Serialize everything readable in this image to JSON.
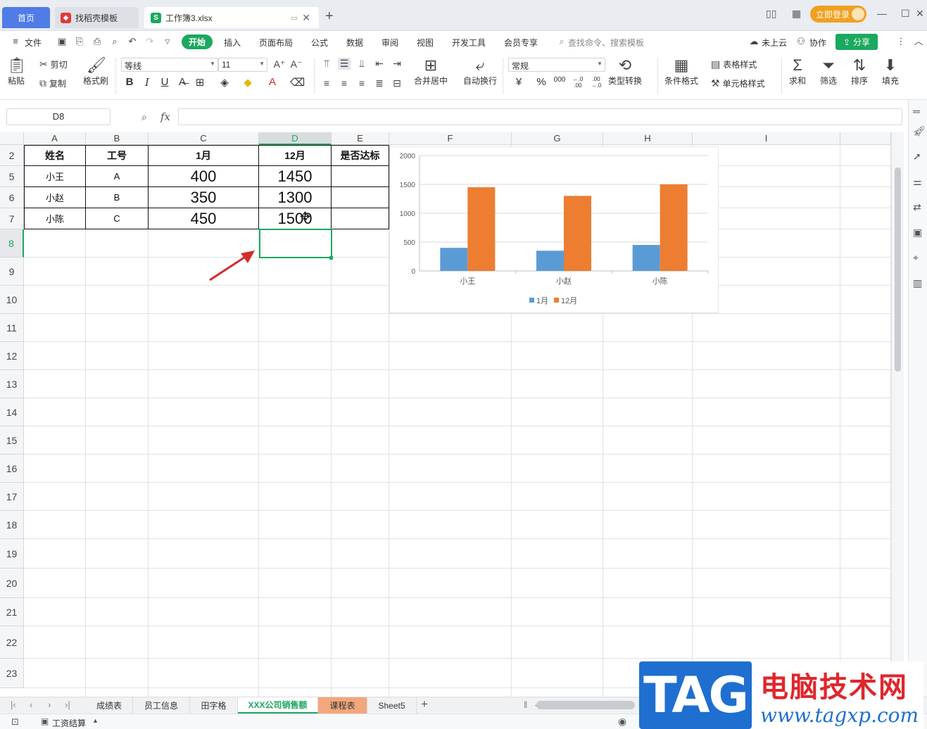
{
  "tabs": {
    "home": "首页",
    "straw": "找稻壳模板",
    "workbook": "工作簿3.xlsx",
    "login": "立即登录"
  },
  "menu": {
    "file": "文件",
    "items": [
      "开始",
      "插入",
      "页面布局",
      "公式",
      "数据",
      "审阅",
      "视图",
      "开发工具",
      "会员专享"
    ],
    "search_placeholder": "查找命令、搜索模板",
    "cloud": "未上云",
    "collab": "协作",
    "share": "分享"
  },
  "ribbon": {
    "paste": "粘贴",
    "cut": "剪切",
    "copy": "复制",
    "format_painter": "格式刷",
    "font_name": "等线",
    "font_size": "11",
    "merge_center": "合并居中",
    "auto_wrap": "自动换行",
    "number_format": "常规",
    "type_convert": "类型转换",
    "cond_format": "条件格式",
    "table_style": "表格样式",
    "cell_style": "单元格样式",
    "sum": "求和",
    "filter": "筛选",
    "sort": "排序",
    "fill": "填充",
    "bold": "B",
    "italic": "I",
    "underline": "U",
    "currency": "¥",
    "percent": "%",
    "thousands": "000",
    "inc_dec": "←.0 .00",
    "dec_dec": ".00 →.0"
  },
  "formula_bar": {
    "name_box": "D8",
    "fx": "fx",
    "value": ""
  },
  "columns": [
    "A",
    "B",
    "C",
    "D",
    "E",
    "F",
    "G",
    "H",
    "I"
  ],
  "rows": [
    "2",
    "5",
    "6",
    "7",
    "8",
    "9",
    "10",
    "11",
    "12",
    "13",
    "14",
    "15",
    "16",
    "17",
    "18",
    "19",
    "20",
    "21",
    "22",
    "23"
  ],
  "table": {
    "headers": [
      "姓名",
      "工号",
      "1月",
      "12月",
      "是否达标"
    ],
    "rows": [
      [
        "小王",
        "A",
        "400",
        "1450",
        ""
      ],
      [
        "小赵",
        "B",
        "350",
        "1300",
        ""
      ],
      [
        "小陈",
        "C",
        "450",
        "1500",
        ""
      ]
    ]
  },
  "chart_data": {
    "type": "bar",
    "categories": [
      "小王",
      "小赵",
      "小陈"
    ],
    "series": [
      {
        "name": "1月",
        "values": [
          400,
          350,
          450
        ],
        "color": "#5b9bd5"
      },
      {
        "name": "12月",
        "values": [
          1450,
          1300,
          1500
        ],
        "color": "#ed7d31"
      }
    ],
    "yticks": [
      "0",
      "500",
      "1000",
      "1500",
      "2000"
    ],
    "ylim": [
      0,
      2000
    ],
    "legend": "bottom",
    "grid": true
  },
  "sheet_tabs": [
    "成绩表",
    "员工信息",
    "田字格",
    "XXX公司销售额",
    "课程表",
    "Sheet5"
  ],
  "active_sheet": "XXX公司销售额",
  "status": {
    "payroll": "工资结算"
  },
  "watermark": {
    "tag": "TAG",
    "site_name": "电脑技术网",
    "url": "www.tagxp.com"
  }
}
